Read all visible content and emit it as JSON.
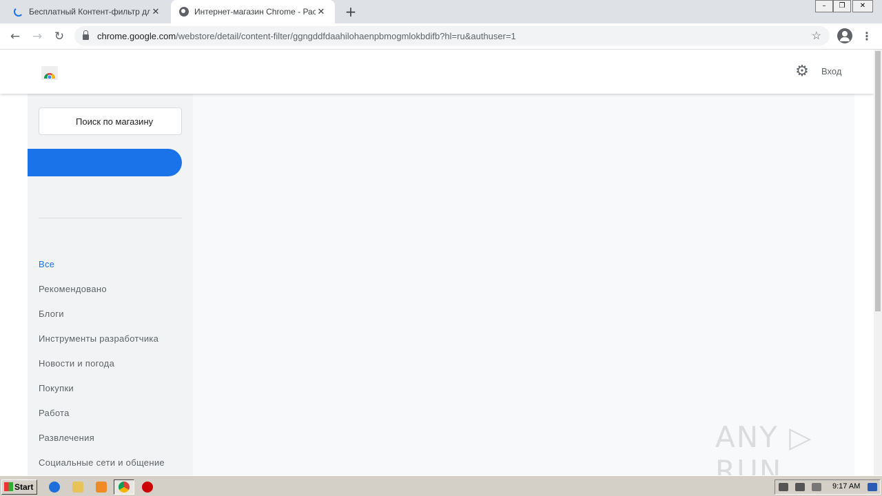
{
  "tabs": [
    {
      "title": "Бесплатный Контент-фильтр для…",
      "state": "loading"
    },
    {
      "title": "Интернет-магазин Chrome - Расш…",
      "state": "active"
    }
  ],
  "tab_close_glyph": "✕",
  "newtab_glyph": "+",
  "window_controls": {
    "minimize": "–",
    "restore": "❐",
    "close": "✕"
  },
  "nav": {
    "back": "←",
    "forward": "→",
    "reload": "↻"
  },
  "omnibox": {
    "host": "chrome.google.com",
    "path": "/webstore/detail/content-filter/ggngddfdaahilohaenpbmogmlokbdifb?hl=ru&authuser=1",
    "star_glyph": "☆"
  },
  "menu_glyph": "⋮",
  "header": {
    "gear_glyph": "⚙",
    "signin": "Вход"
  },
  "sidebar": {
    "search_placeholder": "Поиск по магазину",
    "categories": [
      {
        "label": "Все",
        "active": true
      },
      {
        "label": "Рекомендовано"
      },
      {
        "label": "Блоги"
      },
      {
        "label": "Инструменты разработчика"
      },
      {
        "label": "Новости и погода"
      },
      {
        "label": "Покупки"
      },
      {
        "label": "Работа"
      },
      {
        "label": "Развлечения"
      },
      {
        "label": "Социальные сети и общение"
      }
    ]
  },
  "watermark": "ANY ▷ RUN",
  "taskbar": {
    "start": "Start",
    "clock": "9:17 AM"
  },
  "colors": {
    "accent": "#1a73e8",
    "sidebar_bg": "#f1f3f4",
    "main_bg": "#f8f9fa"
  }
}
